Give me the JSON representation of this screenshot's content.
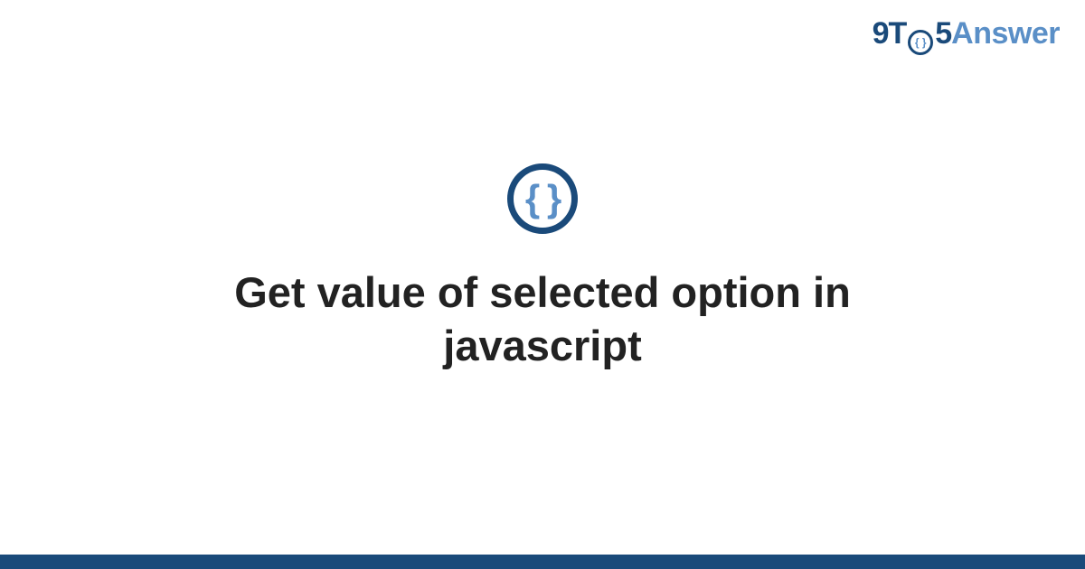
{
  "brand": {
    "part1": "9T",
    "icon_inner": "{ }",
    "part2": "5",
    "part3": "Answer"
  },
  "main": {
    "icon_glyph": "{ }",
    "title": "Get value of selected option in javascript"
  },
  "colors": {
    "primary": "#1a4a7a",
    "accent": "#5a8fc7",
    "text": "#222222",
    "bg": "#ffffff"
  }
}
